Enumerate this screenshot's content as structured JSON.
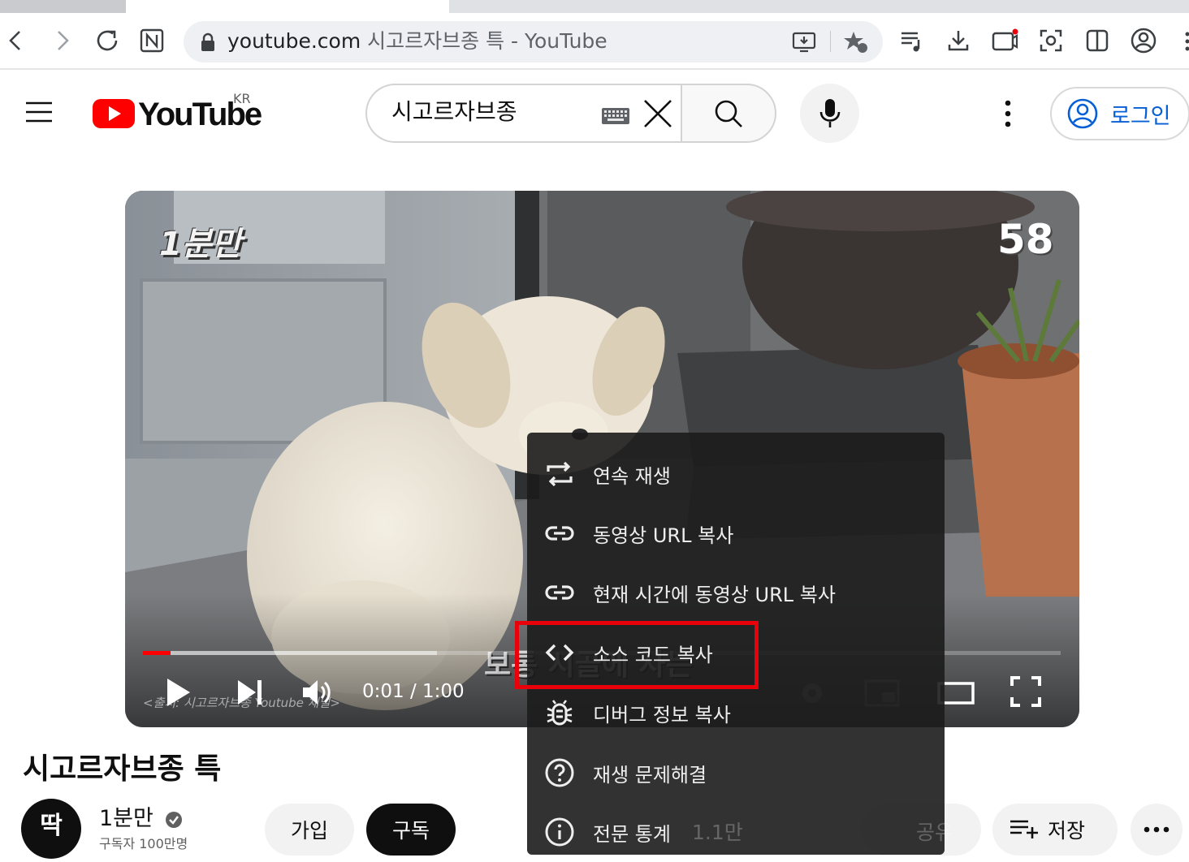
{
  "browser": {
    "url_domain": "youtube.com",
    "url_title": "시고르자브종 특 - YouTube",
    "tab_colors": {
      "active": "#ffffff",
      "inactive": "#dfe1e5"
    }
  },
  "masthead": {
    "logo_text": "YouTube",
    "country_code": "KR",
    "search_value": "시고르자브종",
    "login_label": "로그인",
    "brand_red": "#ff0000",
    "link_blue": "#065fd4"
  },
  "player": {
    "channel_tag": "1분만",
    "countdown": "58",
    "time": "0:01 / 1:00",
    "progress_fraction": 0.03,
    "buffer_fraction": 0.32,
    "subtitle_partial": "보통 시골에 사는",
    "credit_partial": "<출처: 시고르자브종 Youtube 채널>"
  },
  "context_menu": {
    "items": [
      {
        "label": "연속 재생",
        "icon": "loop-icon"
      },
      {
        "label": "동영상 URL 복사",
        "icon": "link-icon"
      },
      {
        "label": "현재 시간에 동영상 URL 복사",
        "icon": "link-icon"
      },
      {
        "label": "소스 코드 복사",
        "icon": "code-icon"
      },
      {
        "label": "디버그 정보 복사",
        "icon": "bug-icon"
      },
      {
        "label": "재생 문제해결",
        "icon": "help-icon"
      },
      {
        "label": "전문 통계",
        "icon": "info-icon"
      }
    ],
    "highlighted_index": 3,
    "highlight_color": "#e8000b"
  },
  "video": {
    "title": "시고르자브종 특",
    "channel_name": "1분만",
    "avatar_text": "딱",
    "subscribers": "구독자 100만명",
    "join_label": "가입",
    "subscribe_label": "구독",
    "likes": "1.1만",
    "share_label": "공유",
    "save_label": "저장"
  }
}
